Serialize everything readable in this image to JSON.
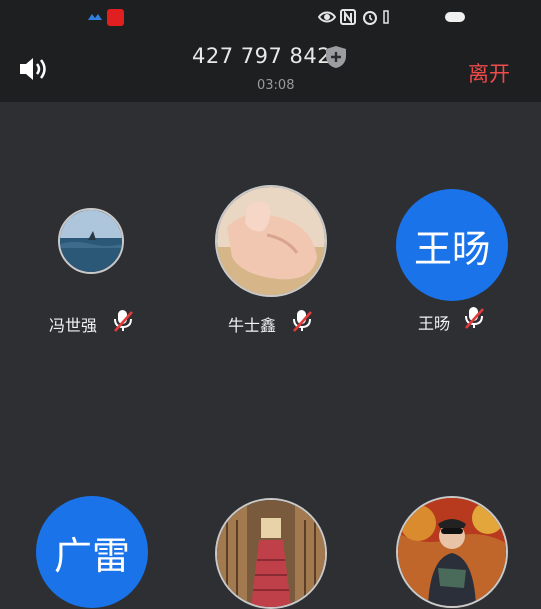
{
  "status_bar": {
    "icons": [
      "app-notification-icon",
      "app-red-badge-icon",
      "eye-icon",
      "nfc-icon",
      "alarm-icon",
      "vibrate-icon",
      "battery-icon"
    ]
  },
  "header": {
    "meeting_id": "427 797 842",
    "duration": "03:08",
    "leave_label": "离开",
    "speaker_icon": "speaker-icon",
    "security_icon": "shield-plus-icon"
  },
  "participants": [
    {
      "name": "冯世强",
      "avatar_type": "photo",
      "avatar_desc": "sea-photo",
      "muted": true
    },
    {
      "name": "牛士鑫",
      "avatar_type": "photo",
      "avatar_desc": "baby-hand-photo",
      "muted": true
    },
    {
      "name": "王旸",
      "avatar_type": "text",
      "avatar_text": "王旸",
      "muted": true
    },
    {
      "name": "",
      "avatar_type": "text",
      "avatar_text": "广雷",
      "muted": false
    },
    {
      "name": "",
      "avatar_type": "photo",
      "avatar_desc": "staircase-photo",
      "muted": false
    },
    {
      "name": "",
      "avatar_type": "photo",
      "avatar_desc": "person-autumn-photo",
      "muted": false
    }
  ],
  "colors": {
    "accent_blue": "#1a73e8",
    "leave_red": "#ef4b4b",
    "mute_red": "#e23b3b",
    "background": "#2d2f33",
    "header_bg": "#1e1f21"
  }
}
